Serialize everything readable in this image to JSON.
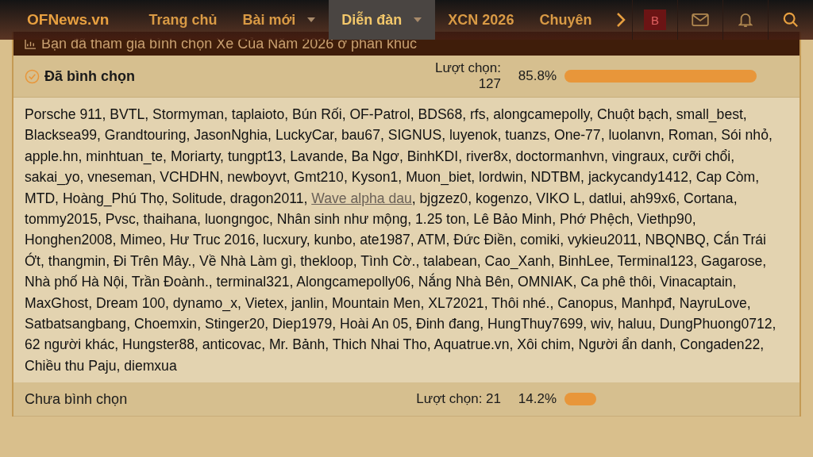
{
  "nav": {
    "logo": "OFNews.vn",
    "items": [
      {
        "label": "Trang chủ",
        "selected": false,
        "has_menu": false
      },
      {
        "label": "Bài mới",
        "selected": false,
        "has_menu": true
      },
      {
        "label": "Diễn đàn",
        "selected": true,
        "has_menu": true
      },
      {
        "label": "XCN 2026",
        "selected": false,
        "has_menu": false
      },
      {
        "label": "Chuyên",
        "selected": false,
        "has_menu": false
      }
    ],
    "avatar": "B"
  },
  "notice": "Bạn đã tham gia bình chọn Xe Của Năm 2026 ở phân khúc",
  "options": [
    {
      "label": "Đã bình chọn",
      "voted": true,
      "votes": "Lượt chọn: 127",
      "percent": "85.8%"
    },
    {
      "label": "Chưa bình chọn",
      "voted": false,
      "votes": "Lượt chọn: 21",
      "percent": "14.2%"
    }
  ],
  "voters": {
    "before": "Porsche 911, BVTL, Stormyman, taplaioto, Bún Rối, OF-Patrol, BDS68, rfs, alongcamepolly, Chuột bạch, small_best, Blacksea99, Grandtouring, JasonNghia, LuckyCar, bau67, SIGNUS, luyenok, tuanzs, One-77, luolanvn, Roman, Sói nhỏ, apple.hn, minhtuan_te, Moriarty, tungpt13, Lavande, Ba Ngơ, BinhKDI, river8x, doctormanhvn, vingraux, cưỡi chổi, sakai_yo, vneseman, VCHDHN, newboyvt, Gmt210, Kyson1, Muon_biet, lordwin, NDTBM, jackycandy1412, Cap Còm, MTD, Hoàng_Phú Thọ, Solitude, dragon2011, ",
    "link": "Wave alpha dau",
    "after": ", bjgzez0, kogenzo, VIKO L, datlui, ah99x6, Cortana, tommy2015, Pvsc, thaihana, luongngoc, Nhân sinh như mộng, 1.25 ton, Lê Bảo Minh, Phớ Phệch, Viethp90, Honghen2008, Mimeo, Hư Truc 2016, lucxury, kunbo, ate1987, ATM, Đức Điền, comiki, vykieu2011, NBQNBQ, Cắn Trái Ớt, thangmin, Đi Trên Mây., Về Nhà Làm gì, thekloop, Tình Cờ., talabean, Cao_Xanh, BinhLee, Terminal123, Gagarose, Nhà phố Hà Nội, Trần Đoành., terminal321, Alongcamepolly06, Nắng Nhà Bên, OMNIAK, Ca phê thôi, Vinacaptain, MaxGhost, Dream 100, dynamo_x, Vietex, janlin, Mountain Men, XL72021, Thôi nhé., Canopus, Manhpđ, NayruLove, Satbatsangbang, Choemxin, Stinger20, Diep1979, Hoài An 05, Đinh đang, HungThuy7699, wiv, haluu, DungPhuong0712, 62 người khác, Hungster88, anticovac, Mr. Bảnh, Thich Nhai Tho, Aquatrue.vn, Xôi chim, Người ẩn danh, Congaden22, Chiều thu Paju, diemxua"
  }
}
